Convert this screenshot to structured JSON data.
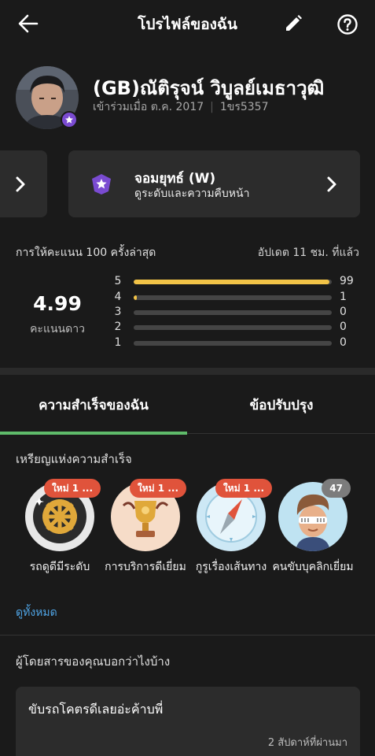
{
  "header": {
    "title": "โปรไฟล์ของฉัน",
    "back_icon": "arrow-left-icon",
    "edit_icon": "pencil-icon",
    "help_icon": "question-circle-icon"
  },
  "profile": {
    "name": "(GB)ณัติรุจน์ วิบูลย์เมธาวุฒิ",
    "joined": "เข้าร่วมเมื่อ ต.ค. 2017",
    "plate": "1ขร5357",
    "avatar_badge_icon": "star-icon"
  },
  "tier_card": {
    "title": "จอมยุทธ์ (W)",
    "subtitle": "ดูระดับและความคืบหน้า",
    "icon": "purple-star-shield-icon",
    "accent": "#7a4bd1"
  },
  "ratings": {
    "header": "การให้คะแนน 100 ครั้งล่าสุด",
    "updated": "อัปเดต 11 ชม. ที่แล้ว",
    "score": "4.99",
    "score_label": "คะแนนดาว",
    "bar_color": "#f2c347",
    "rows": [
      {
        "star": "5",
        "count": "99",
        "fraction": 0.99
      },
      {
        "star": "4",
        "count": "1",
        "fraction": 0.01
      },
      {
        "star": "3",
        "count": "0",
        "fraction": 0
      },
      {
        "star": "2",
        "count": "0",
        "fraction": 0
      },
      {
        "star": "1",
        "count": "0",
        "fraction": 0
      }
    ]
  },
  "tabs": [
    {
      "label": "ความสำเร็จของฉัน",
      "active": true
    },
    {
      "label": "ข้อปรับปรุง",
      "active": false
    }
  ],
  "tab_accent": "#5fbb6a",
  "achievements": {
    "heading": "เหรียญแห่งความสำเร็จ",
    "medals": [
      {
        "label": "รถดูดีมีระดับ",
        "badge": "ใหม่ 1 ...",
        "icon": "car-wheel-icon"
      },
      {
        "label": "การบริการดีเยี่ยม",
        "badge": "ใหม่ 1 ...",
        "icon": "trophy-icon"
      },
      {
        "label": "กูรูเรื่องเส้นทาง",
        "badge": "ใหม่ 1 ...",
        "icon": "compass-icon"
      },
      {
        "label": "คนขับบุคลิกเยี่ยม",
        "badge": "47",
        "icon": "cool-driver-icon"
      }
    ],
    "see_all": "ดูทั้งหมด"
  },
  "feedback": {
    "heading": "ผู้โดยสารของคุณบอกว่าไงบ้าง",
    "review_text": "ขับรถโคตรดีเลยอ่ะค้าบพี่",
    "review_time": "2 สัปดาห์ที่ผ่านมา"
  }
}
